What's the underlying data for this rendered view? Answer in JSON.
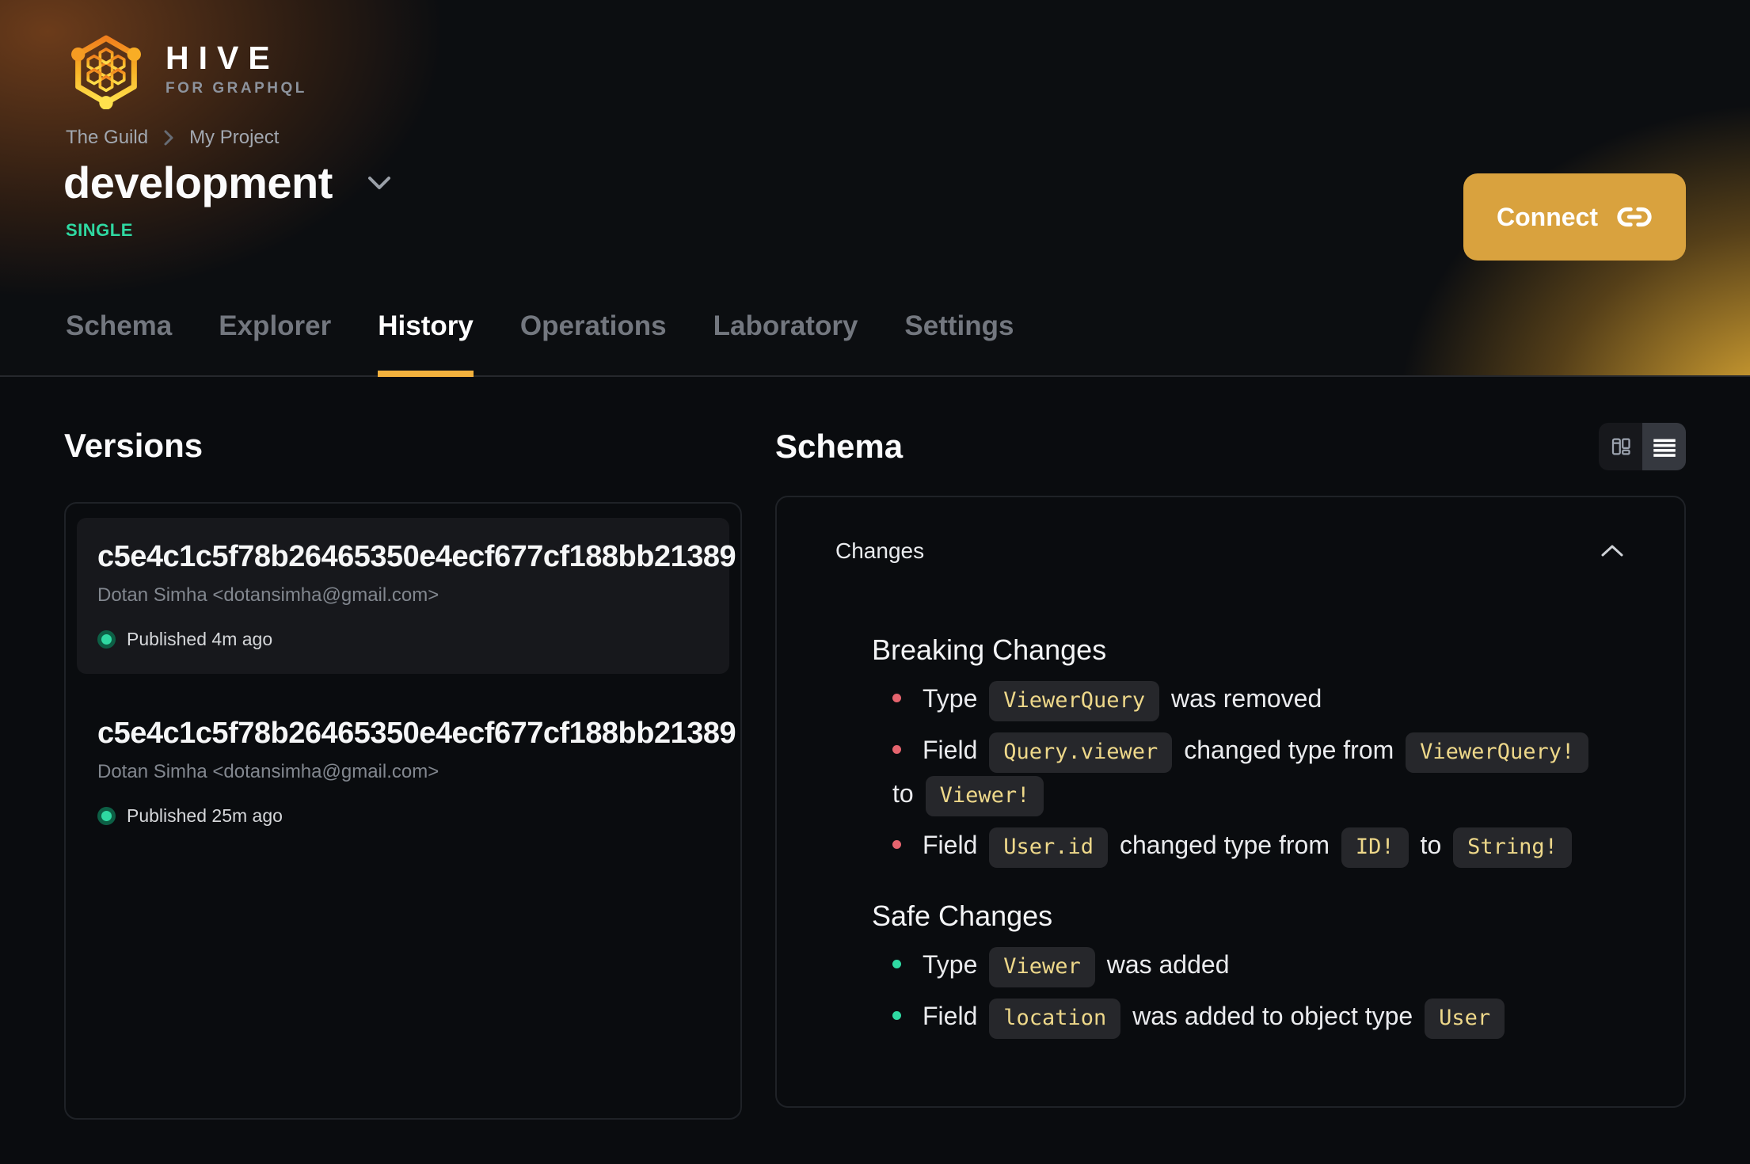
{
  "brand": {
    "name": "HIVE",
    "tagline": "FOR GRAPHQL"
  },
  "breadcrumb": {
    "org": "The Guild",
    "project": "My Project"
  },
  "target": {
    "name": "development",
    "badge": "SINGLE"
  },
  "connect": {
    "label": "Connect"
  },
  "tabs": [
    {
      "label": "Schema",
      "active": false
    },
    {
      "label": "Explorer",
      "active": false
    },
    {
      "label": "History",
      "active": true
    },
    {
      "label": "Operations",
      "active": false
    },
    {
      "label": "Laboratory",
      "active": false
    },
    {
      "label": "Settings",
      "active": false
    }
  ],
  "versions": {
    "title": "Versions",
    "items": [
      {
        "hash": "c5e4c1c5f78b26465350e4ecf677cf188bb21389",
        "author": "Dotan Simha <dotansimha@gmail.com>",
        "status": "Published 4m ago",
        "active": true
      },
      {
        "hash": "c5e4c1c5f78b26465350e4ecf677cf188bb21389",
        "author": "Dotan Simha <dotansimha@gmail.com>",
        "status": "Published 25m ago",
        "active": false
      }
    ]
  },
  "schema": {
    "title": "Schema",
    "view_modes": [
      {
        "name": "columns-view",
        "active": false
      },
      {
        "name": "list-view",
        "active": true
      }
    ],
    "changes": {
      "title": "Changes",
      "breaking": {
        "title": "Breaking Changes",
        "items": [
          [
            {
              "t": "Type "
            },
            {
              "c": "ViewerQuery"
            },
            {
              "t": " was removed"
            }
          ],
          [
            {
              "t": "Field "
            },
            {
              "c": "Query.viewer"
            },
            {
              "t": " changed type from "
            },
            {
              "c": "ViewerQuery!"
            },
            {
              "br": true
            },
            {
              "t": "to "
            },
            {
              "c": "Viewer!"
            }
          ],
          [
            {
              "t": "Field "
            },
            {
              "c": "User.id"
            },
            {
              "t": " changed type from "
            },
            {
              "c": "ID!"
            },
            {
              "t": " to "
            },
            {
              "c": "String!"
            }
          ]
        ]
      },
      "safe": {
        "title": "Safe Changes",
        "items": [
          [
            {
              "t": "Type "
            },
            {
              "c": "Viewer"
            },
            {
              "t": " was added"
            }
          ],
          [
            {
              "t": "Field "
            },
            {
              "c": "location"
            },
            {
              "t": " was added to object type "
            },
            {
              "c": "User"
            }
          ]
        ]
      }
    }
  },
  "icons": {
    "hive-logo-icon": "hexagon honeycomb",
    "chevron-right-icon": "›",
    "chevron-down-icon": "v",
    "chevron-up-icon": "^",
    "link-icon": "chain link",
    "columns-view-icon": "two columns",
    "list-view-icon": "stacked lines",
    "published-dot-icon": "green circle",
    "bullet-icon": "dot"
  },
  "colors": {
    "accent": "#f2b13d",
    "connect_button": "#d9a23e",
    "safe_green": "#2fd9a2",
    "breaking_red": "#e5646e",
    "code_text": "#eed88a",
    "code_bg": "#26272b",
    "page_bg": "#0a0c0f"
  }
}
